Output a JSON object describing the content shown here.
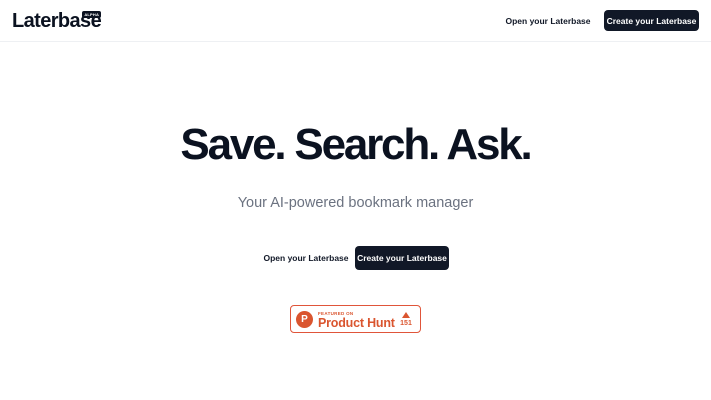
{
  "header": {
    "logo_text": "Laterbase",
    "logo_badge": "ALPHA",
    "open_label": "Open your Laterbase",
    "create_label": "Create your Laterbase"
  },
  "hero": {
    "title": "Save. Search. Ask.",
    "subtitle": "Your AI-powered bookmark manager",
    "open_label": "Open your Laterbase",
    "create_label": "Create your Laterbase"
  },
  "product_hunt": {
    "letter": "P",
    "featured_label": "FEATURED ON",
    "name": "Product Hunt",
    "upvotes": "151",
    "icon": "product-hunt-logo-icon",
    "arrow_icon": "upvote-arrow-icon",
    "brand_color": "#da552f"
  },
  "colors": {
    "primary_dark": "#111827",
    "text_muted": "#6b7280"
  }
}
